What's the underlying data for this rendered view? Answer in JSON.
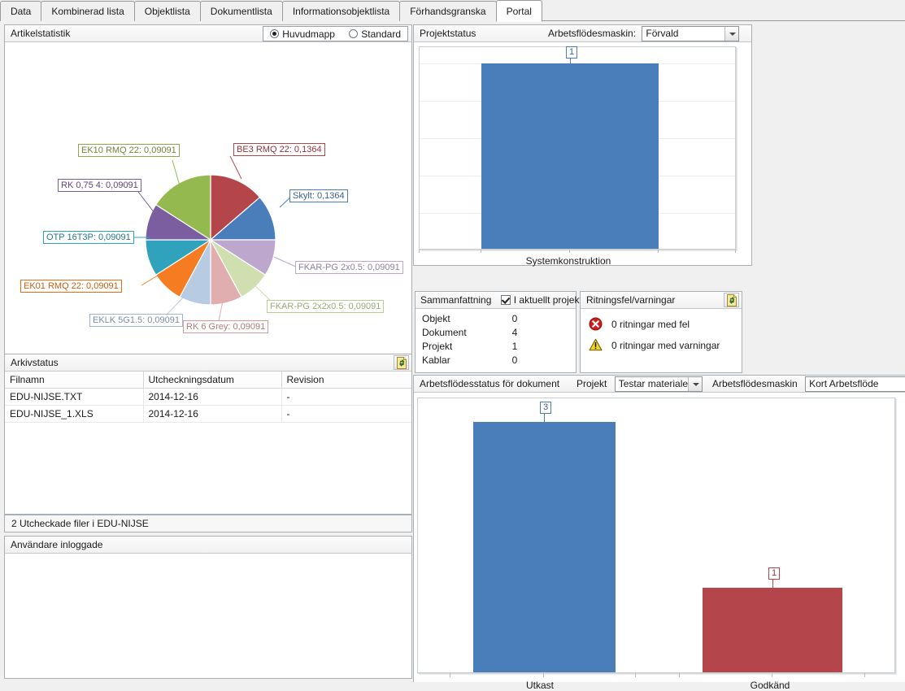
{
  "tabs": [
    {
      "label": "Data",
      "selected": false
    },
    {
      "label": "Kombinerad lista",
      "selected": false
    },
    {
      "label": "Objektlista",
      "selected": false
    },
    {
      "label": "Dokumentlista",
      "selected": false
    },
    {
      "label": "Informationsobjektlista",
      "selected": false
    },
    {
      "label": "Förhandsgranska",
      "selected": false
    },
    {
      "label": "Portal",
      "selected": true
    }
  ],
  "article_stats": {
    "title": "Artikelstatistik",
    "radio_main": "Huvudmapp",
    "radio_standard": "Standard",
    "selected_radio": "Huvudmapp"
  },
  "project_status": {
    "title": "Projektstatus",
    "workflow_label": "Arbetsflödesmaskin:",
    "workflow_value": "Förvald"
  },
  "summary": {
    "title": "Sammanfattning",
    "checkbox_label": "I aktuellt projekt",
    "checkbox_checked": true,
    "rows": [
      {
        "label": "Objekt",
        "value": "0"
      },
      {
        "label": "Dokument",
        "value": "4"
      },
      {
        "label": "Projekt",
        "value": "1"
      },
      {
        "label": "Kablar",
        "value": "0"
      }
    ]
  },
  "drawing_issues": {
    "title": "Ritningsfel/varningar",
    "refresh_icon": "refresh-document-icon",
    "rows": [
      {
        "icon": "error-icon",
        "text": "0 ritningar med fel"
      },
      {
        "icon": "warning-icon",
        "text": "0 ritningar med varningar"
      }
    ]
  },
  "archive_status": {
    "title": "Arkivstatus",
    "refresh_icon": "refresh-document-icon",
    "columns": [
      "Filnamn",
      "Utcheckningsdatum",
      "Revision"
    ],
    "rows": [
      [
        "EDU-NIJSE.TXT",
        "2014-12-16",
        "-"
      ],
      [
        "EDU-NIJSE_1.XLS",
        "2014-12-16",
        "-"
      ]
    ],
    "statusbar": "2 Utcheckade filer i EDU-NIJSE"
  },
  "users_logged_in": {
    "title": "Användare inloggade"
  },
  "workflow_doc_status": {
    "title": "Arbetsflödesstatus för dokument",
    "project_label": "Projekt",
    "project_value": "Testar materiale",
    "machine_label": "Arbetsflödesmaskin",
    "machine_value": "Kort Arbetsflöde"
  },
  "chart_data": [
    {
      "type": "pie",
      "title": "Artikelstatistik",
      "labels": [
        "BE3 RMQ 22",
        "Skylt",
        "FKAR-PG 2x0.5",
        "FKAR-PG 2x2x0.5",
        "RK 6 Grey",
        "EKLK 5G1.5",
        "EK01 RMQ 22",
        "OTP 16T3P",
        "RK 0,75 4",
        "EK10 RMQ 22"
      ],
      "values": [
        0.1364,
        0.1364,
        0.09091,
        0.09091,
        0.09091,
        0.09091,
        0.09091,
        0.09091,
        0.09091,
        0.09091
      ],
      "value_texts": [
        "0,1364",
        "0,1364",
        "0,09091",
        "0,09091",
        "0,09091",
        "0,09091",
        "0,09091",
        "0,09091",
        "0,09091",
        "0,09091"
      ],
      "label_texts": [
        "BE3 RMQ 22: 0,1364",
        "Skylt: 0,1364",
        "FKAR-PG 2x0.5: 0,09091",
        "FKAR-PG 2x2x0.5: 0,09091",
        "RK 6 Grey: 0,09091",
        "EKLK 5G1.5: 0,09091",
        "EK01 RMQ 22: 0,09091",
        "OTP 16T3P: 0,09091",
        "RK 0,75 4: 0,09091",
        "EK10 RMQ 22: 0,09091"
      ],
      "colors": [
        "#b4464b",
        "#4a7ebb",
        "#bda7cd",
        "#cfdfb0",
        "#e0aeae",
        "#b7cbe3",
        "#f57c20",
        "#31a2bb",
        "#7b5ea0",
        "#94ba4f"
      ],
      "legend": "none"
    },
    {
      "type": "bar",
      "title": "Projektstatus",
      "categories": [
        "Systemkonstruktion"
      ],
      "values": [
        1
      ],
      "value_labels": [
        "1"
      ],
      "colors": [
        "#4a7ebb"
      ],
      "ylim": [
        0,
        1.1
      ],
      "grid": true,
      "xlabel": "",
      "ylabel": ""
    },
    {
      "type": "bar",
      "title": "Arbetsflödesstatus för dokument",
      "categories": [
        "Utkast",
        "Godkänd"
      ],
      "values": [
        3,
        1
      ],
      "value_labels": [
        "3",
        "1"
      ],
      "colors": [
        "#4a7ebb",
        "#b4464b"
      ],
      "ylim": [
        0,
        3.3
      ],
      "grid": false,
      "xlabel": "",
      "ylabel": ""
    }
  ]
}
